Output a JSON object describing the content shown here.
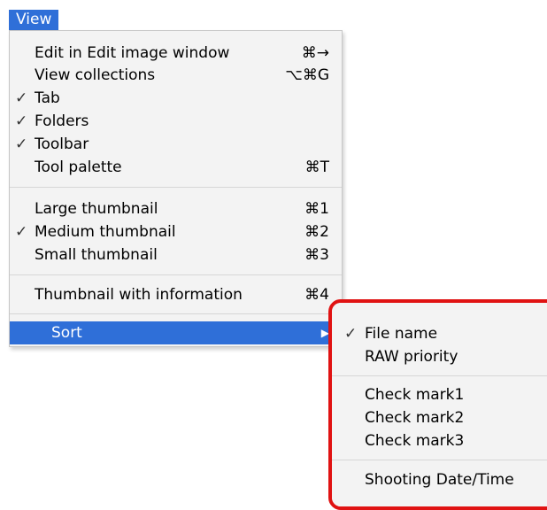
{
  "menubar": {
    "view_label": "View"
  },
  "menu": {
    "items": [
      {
        "label": "Edit in Edit image window",
        "shortcut": "⌘→",
        "checked": false
      },
      {
        "label": "View collections",
        "shortcut": "⌥⌘G",
        "checked": false
      },
      {
        "label": "Tab",
        "shortcut": "",
        "checked": true
      },
      {
        "label": "Folders",
        "shortcut": "",
        "checked": true
      },
      {
        "label": "Toolbar",
        "shortcut": "",
        "checked": true
      },
      {
        "label": "Tool palette",
        "shortcut": "⌘T",
        "checked": false
      },
      {
        "label": "Large thumbnail",
        "shortcut": "⌘1",
        "checked": false
      },
      {
        "label": "Medium thumbnail",
        "shortcut": "⌘2",
        "checked": true
      },
      {
        "label": "Small thumbnail",
        "shortcut": "⌘3",
        "checked": false
      },
      {
        "label": "Thumbnail with information",
        "shortcut": "⌘4",
        "checked": false
      },
      {
        "label": "Sort",
        "shortcut": "▶",
        "checked": false
      }
    ]
  },
  "submenu": {
    "items": [
      {
        "label": "File name",
        "checked": true
      },
      {
        "label": "RAW priority",
        "checked": false
      },
      {
        "label": "Check mark1",
        "checked": false
      },
      {
        "label": "Check mark2",
        "checked": false
      },
      {
        "label": "Check mark3",
        "checked": false
      },
      {
        "label": "Shooting Date/Time",
        "checked": false
      }
    ]
  },
  "glyphs": {
    "checkmark": "✓"
  },
  "colors": {
    "highlight": "#2f6fd8",
    "callout_border": "#e01212"
  }
}
